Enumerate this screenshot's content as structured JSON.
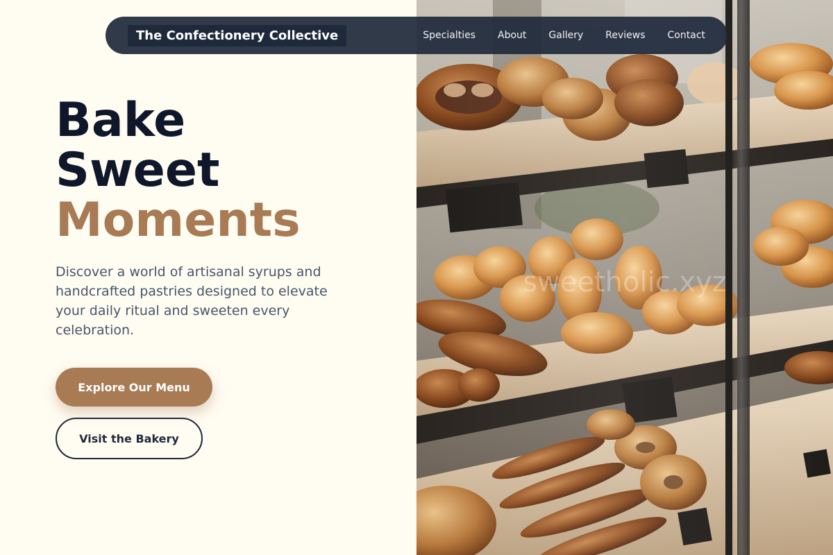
{
  "nav": {
    "brand": "The Confectionery Collective",
    "links": [
      "Specialties",
      "About",
      "Gallery",
      "Reviews",
      "Contact"
    ]
  },
  "hero": {
    "headline": [
      "Bake",
      "Sweet",
      "Moments"
    ],
    "description": "Discover a world of artisanal syrups and handcrafted pastries designed to elevate your daily ritual and sweeten every celebration.",
    "primary_button": "Explore Our Menu",
    "secondary_button": "Visit the Bakery",
    "image_watermark": "sweetholic.xyz"
  },
  "colors": {
    "background": "#fffcf2",
    "accent": "#a87b55",
    "text_dark": "#0f172a",
    "nav_bg": "#1e293b"
  }
}
